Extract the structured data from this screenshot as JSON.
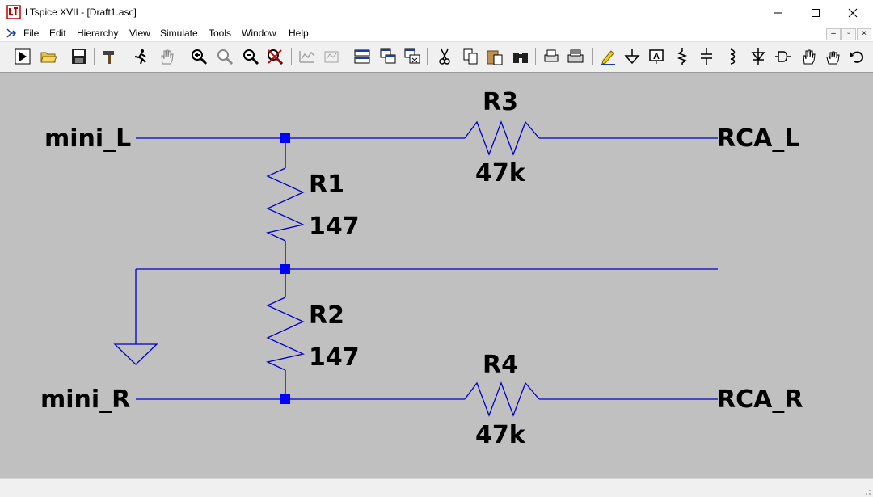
{
  "window": {
    "title": "LTspice XVII - [Draft1.asc]",
    "app_icon": "ltspice-logo",
    "controls": [
      "minimize-icon",
      "maximize-icon",
      "close-icon"
    ]
  },
  "menu": {
    "items": [
      {
        "label": "File"
      },
      {
        "label": "Edit"
      },
      {
        "label": "Hierarchy"
      },
      {
        "label": "View"
      },
      {
        "label": "Simulate"
      },
      {
        "label": "Tools"
      },
      {
        "label": "Window"
      },
      {
        "label": "Help"
      }
    ],
    "mdi_controls": [
      "mdi-minimize-icon",
      "mdi-restore-icon",
      "mdi-close-icon"
    ]
  },
  "toolbar": {
    "buttons": [
      "run-icon",
      "open-icon",
      "save-icon",
      "control-panel-hammer-icon",
      "halt-running-man-icon",
      "pan-hand-icon",
      "zoom-in-icon",
      "zoom-area-icon",
      "zoom-out-icon",
      "zoom-cancel-icon",
      "autorange-icon",
      "waveform-icon",
      "tile-windows-icon",
      "cascade-windows-icon",
      "close-windows-icon",
      "cut-scissors-icon",
      "copy-icon",
      "paste-icon",
      "find-binoculars-icon",
      "print-preview-icon",
      "print-icon",
      "draw-wire-pencil-icon",
      "ground-icon",
      "label-net-icon",
      "resistor-icon",
      "capacitor-icon",
      "inductor-icon",
      "diode-icon",
      "component-icon",
      "move-hand-icon",
      "drag-hand-icon",
      "undo-icon"
    ]
  },
  "schematic": {
    "wire_color": "#0000c8",
    "junction_color": "#0000ff",
    "background": "#c0c0c0",
    "net_labels": {
      "mini_L": "mini_L",
      "mini_R": "mini_R",
      "RCA_L": "RCA_L",
      "RCA_R": "RCA_R"
    },
    "components": [
      {
        "ref": "R1",
        "value": "147"
      },
      {
        "ref": "R2",
        "value": "147"
      },
      {
        "ref": "R3",
        "value": "47k"
      },
      {
        "ref": "R4",
        "value": "47k"
      }
    ],
    "ground_symbol": "ground-icon"
  }
}
